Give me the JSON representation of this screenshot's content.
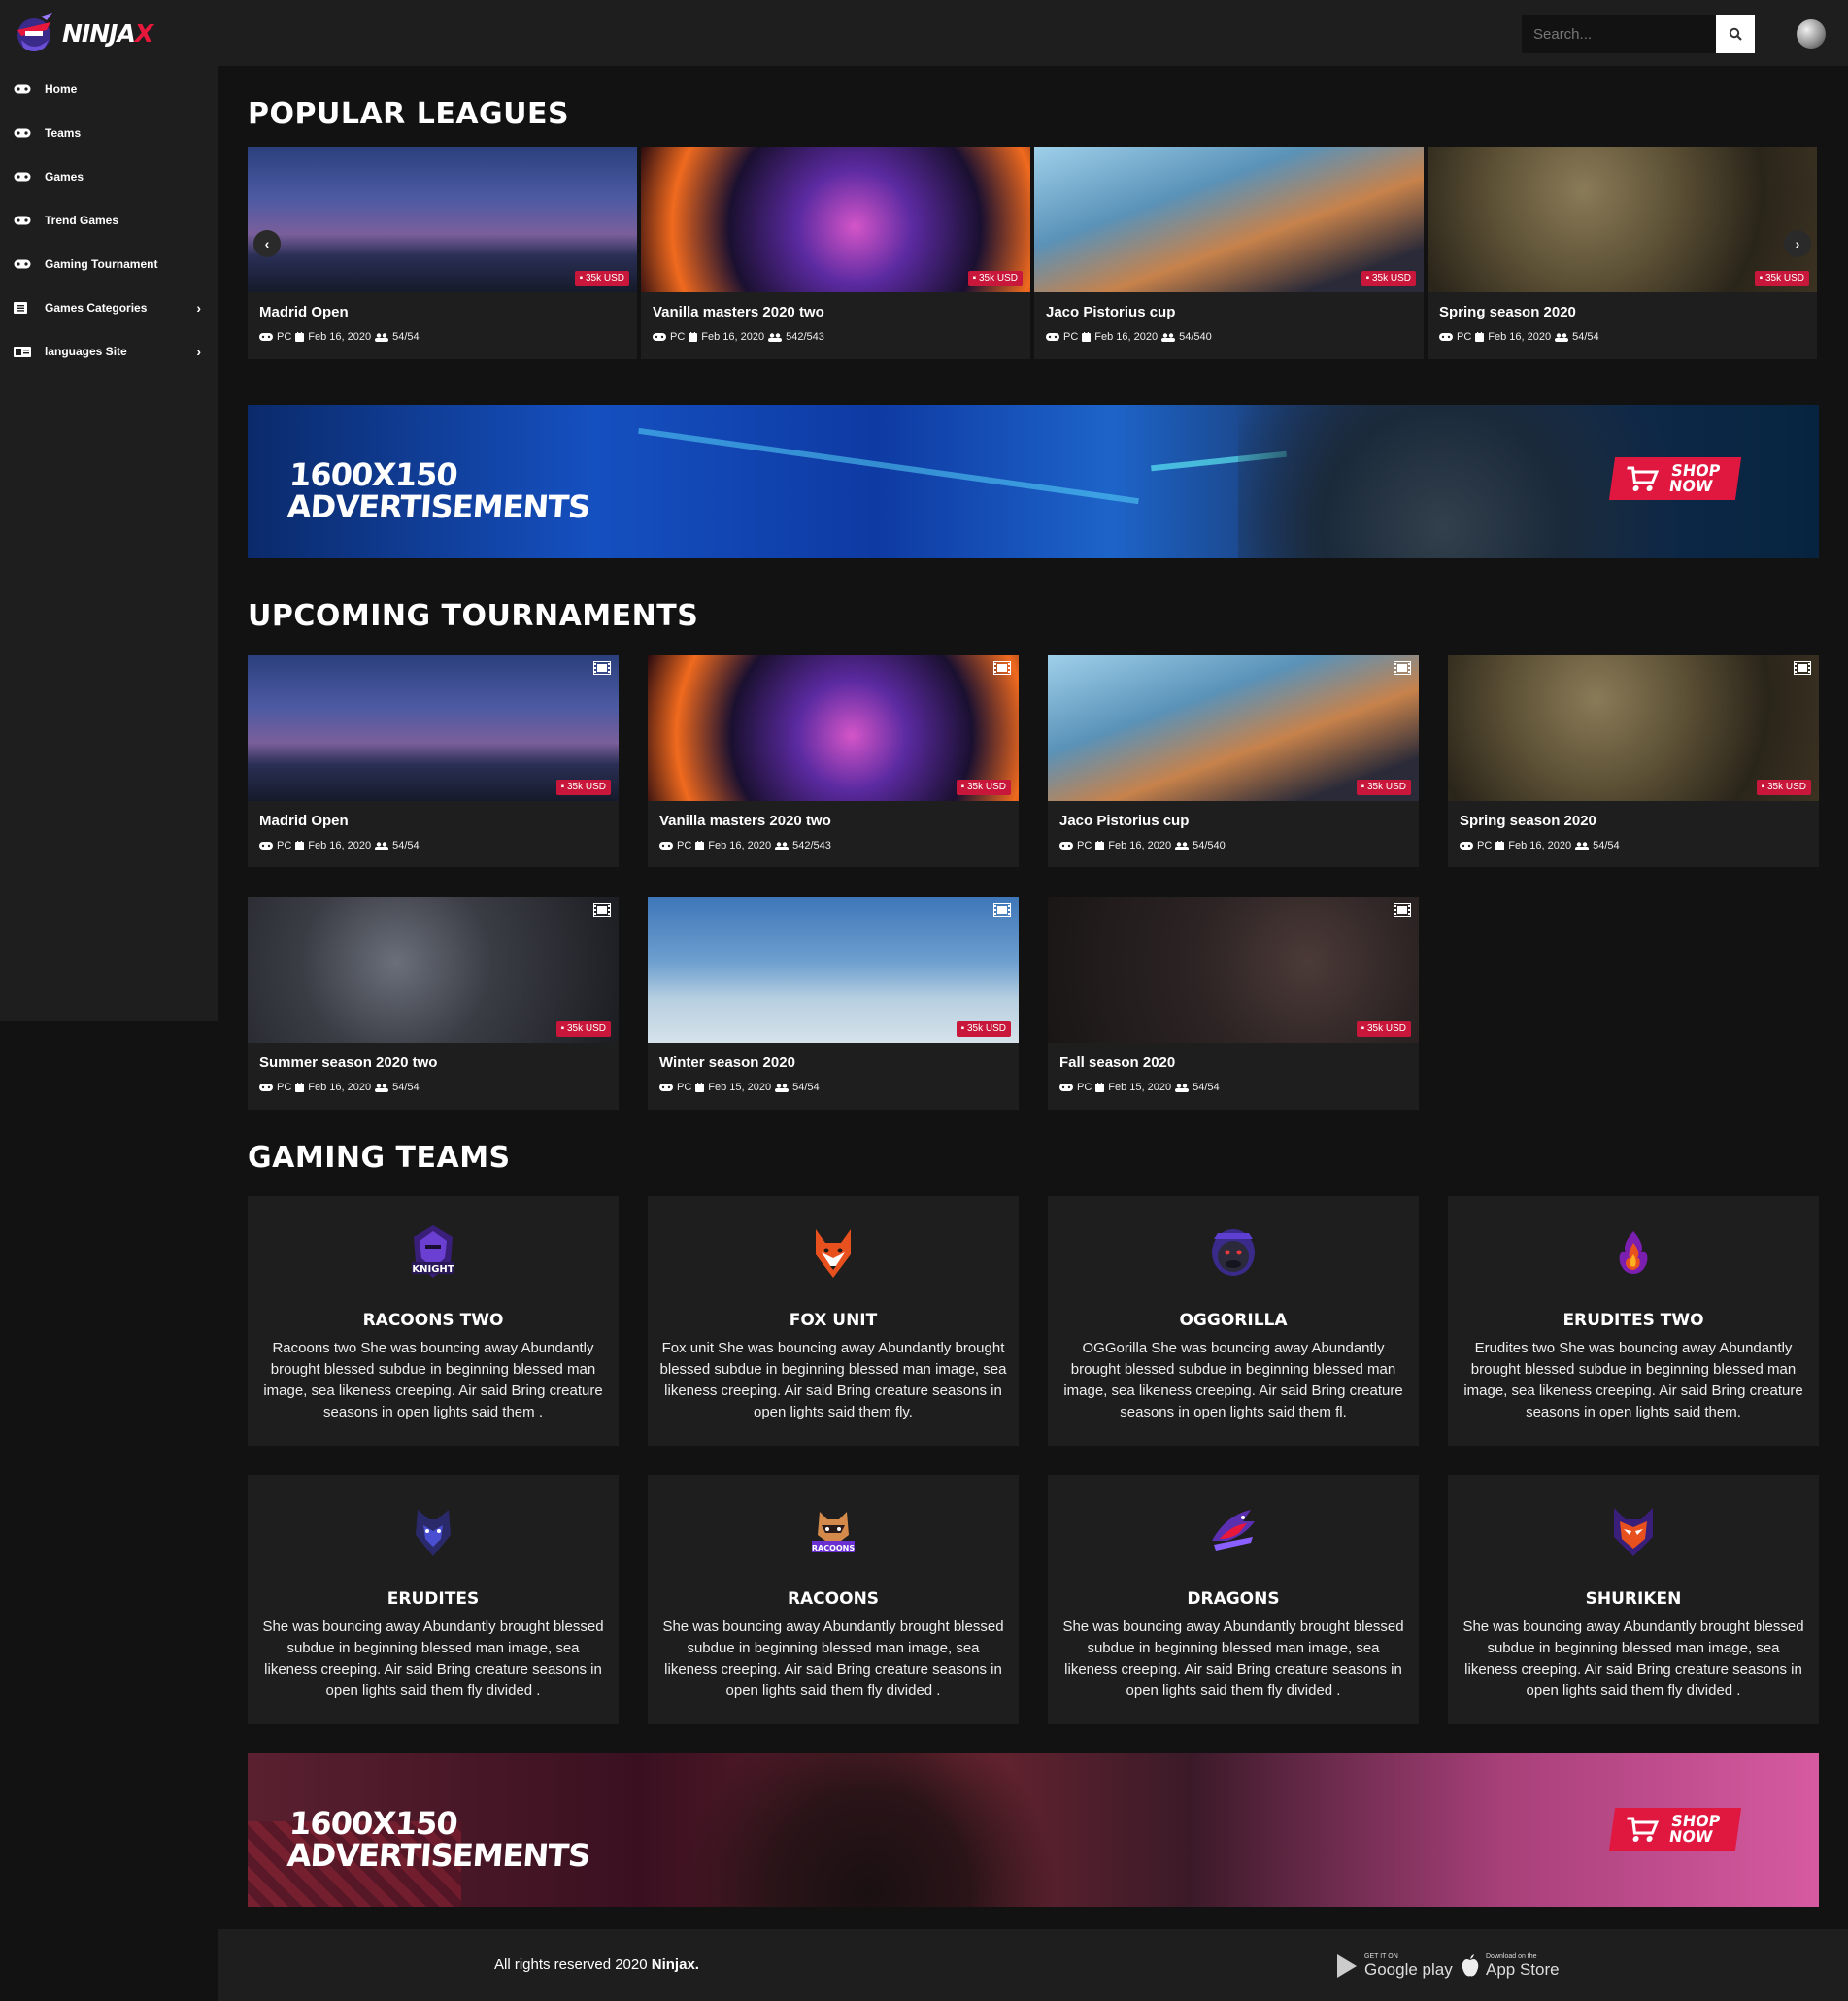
{
  "header": {
    "logo_main": "NINJA",
    "logo_accent": "X",
    "search_placeholder": "Search..."
  },
  "sidebar": {
    "items": [
      {
        "label": "Home",
        "icon": "gamepad-icon"
      },
      {
        "label": "Teams",
        "icon": "gamepad-icon"
      },
      {
        "label": "Games",
        "icon": "gamepad-icon"
      },
      {
        "label": "Trend Games",
        "icon": "gamepad-icon"
      },
      {
        "label": "Gaming Tournament",
        "icon": "gamepad-icon"
      },
      {
        "label": "Games Categories",
        "icon": "list-icon",
        "has_submenu": true
      },
      {
        "label": "languages Site",
        "icon": "language-icon",
        "has_submenu": true
      }
    ]
  },
  "popular": {
    "title": "POPULAR LEAGUES",
    "cards": [
      {
        "title": "Madrid Open",
        "platform": "PC",
        "date": "Feb 16, 2020",
        "players": "54/54",
        "price": "35k USD"
      },
      {
        "title": "Vanilla masters 2020 two",
        "platform": "PC",
        "date": "Feb 16, 2020",
        "players": "542/543",
        "price": "35k USD"
      },
      {
        "title": "Jaco Pistorius cup",
        "platform": "PC",
        "date": "Feb 16, 2020",
        "players": "54/540",
        "price": "35k USD"
      },
      {
        "title": "Spring season 2020",
        "platform": "PC",
        "date": "Feb 16, 2020",
        "players": "54/54",
        "price": "35k USD"
      }
    ]
  },
  "ads": {
    "line1": "1600X150",
    "line2": "ADVERTISEMENTS",
    "shop_line1": "SHOP",
    "shop_line2": "NOW"
  },
  "upcoming": {
    "title": "UPCOMING TOURNAMENTS",
    "cards": [
      {
        "title": "Madrid Open",
        "platform": "PC",
        "date": "Feb 16, 2020",
        "players": "54/54",
        "price": "35k USD"
      },
      {
        "title": "Vanilla masters 2020 two",
        "platform": "PC",
        "date": "Feb 16, 2020",
        "players": "542/543",
        "price": "35k USD"
      },
      {
        "title": "Jaco Pistorius cup",
        "platform": "PC",
        "date": "Feb 16, 2020",
        "players": "54/540",
        "price": "35k USD"
      },
      {
        "title": "Spring season 2020",
        "platform": "PC",
        "date": "Feb 16, 2020",
        "players": "54/54",
        "price": "35k USD"
      },
      {
        "title": "Summer season 2020 two",
        "platform": "PC",
        "date": "Feb 16, 2020",
        "players": "54/54",
        "price": "35k USD"
      },
      {
        "title": "Winter season 2020",
        "platform": "PC",
        "date": "Feb 15, 2020",
        "players": "54/54",
        "price": "35k USD"
      },
      {
        "title": "Fall season 2020",
        "platform": "PC",
        "date": "Feb 15, 2020",
        "players": "54/54",
        "price": "35k USD"
      }
    ]
  },
  "teams": {
    "title": "GAMING TEAMS",
    "items": [
      {
        "name": "RACOONS TWO",
        "logo_text": "KNIGHT",
        "desc": "Racoons two She was bouncing away Abundantly brought blessed subdue in beginning blessed man image, sea likeness creeping. Air said Bring creature seasons in open lights said them ."
      },
      {
        "name": "FOX UNIT",
        "logo_text": "",
        "desc": "Fox unit She was bouncing away Abundantly brought blessed subdue in beginning blessed man image, sea likeness creeping. Air said Bring creature seasons in open lights said them fly."
      },
      {
        "name": "OGGORILLA",
        "logo_text": "",
        "desc": "OGGorilla She was bouncing away Abundantly brought blessed subdue in beginning blessed man image, sea likeness creeping. Air said Bring creature seasons in open lights said them fl."
      },
      {
        "name": "ERUDITES TWO",
        "logo_text": "",
        "desc": "Erudites two She was bouncing away Abundantly brought blessed subdue in beginning blessed man image, sea likeness creeping. Air said Bring creature seasons in open lights said them."
      },
      {
        "name": "ERUDITES",
        "logo_text": "",
        "desc": "She was bouncing away Abundantly brought blessed subdue in beginning blessed man image, sea likeness creeping. Air said Bring creature seasons in open lights said them fly divided ."
      },
      {
        "name": "RACOONS",
        "logo_text": "RACOONS",
        "desc": "She was bouncing away Abundantly brought blessed subdue in beginning blessed man image, sea likeness creeping. Air said Bring creature seasons in open lights said them fly divided ."
      },
      {
        "name": "DRAGONS",
        "logo_text": "",
        "desc": "She was bouncing away Abundantly brought blessed subdue in beginning blessed man image, sea likeness creeping. Air said Bring creature seasons in open lights said them fly divided ."
      },
      {
        "name": "SHURIKEN",
        "logo_text": "",
        "desc": "She was bouncing away Abundantly brought blessed subdue in beginning blessed man image, sea likeness creeping. Air said Bring creature seasons in open lights said them fly divided ."
      }
    ]
  },
  "footer": {
    "copy_prefix": "All rights reserved 2020",
    "copy_brand": "Ninjax.",
    "google_small": "GET IT ON",
    "google_big": "Google play",
    "apple_small": "Download on the",
    "apple_big": "App Store"
  },
  "colors": {
    "background": "#121212",
    "panel": "#1e1e1e",
    "accent": "#e8173c"
  }
}
